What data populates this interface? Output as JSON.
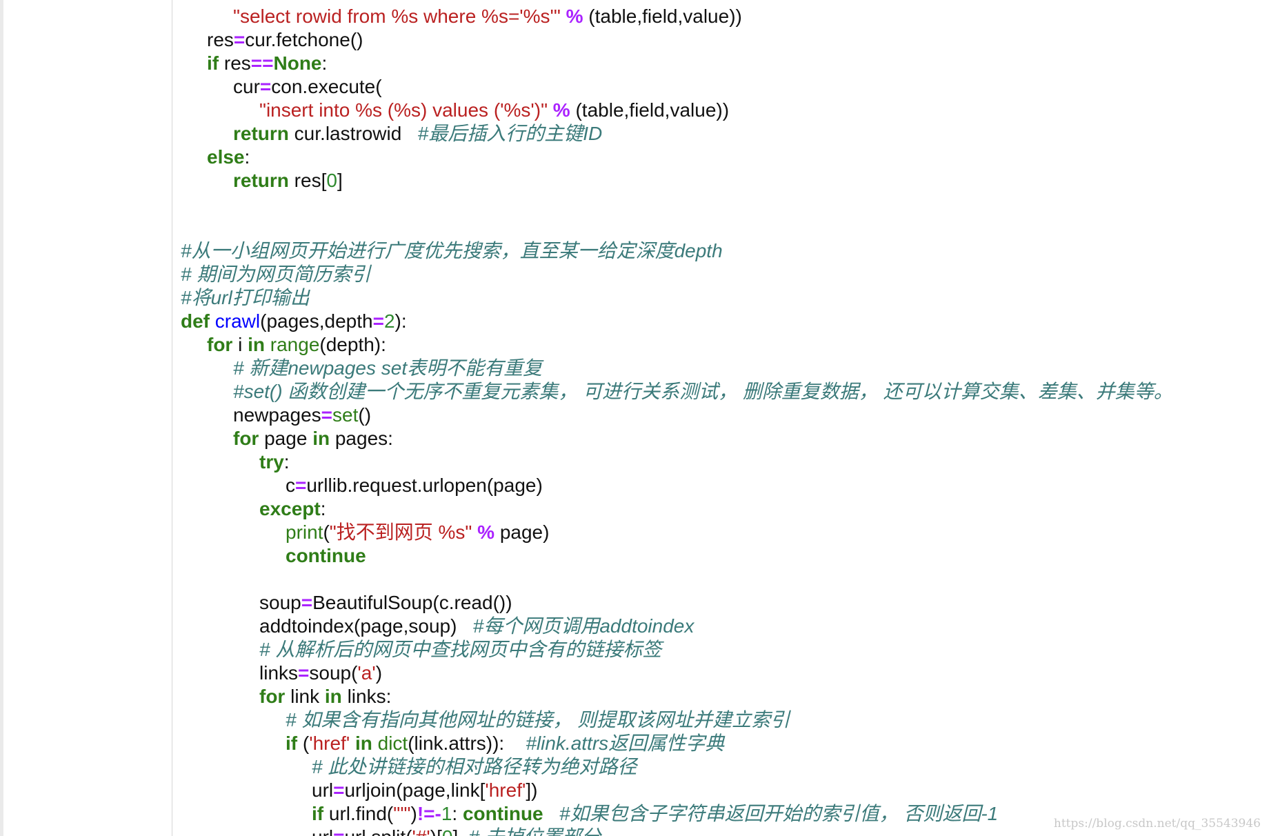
{
  "watermark": "https://blog.csdn.net/qq_35543946",
  "code_lines": [
    {
      "indent": 2,
      "tokens": [
        {
          "t": "str",
          "v": "\"select rowid from %s where %s='%s'\""
        },
        {
          "t": "pl",
          "v": " "
        },
        {
          "t": "op",
          "v": "%"
        },
        {
          "t": "pl",
          "v": " (table,field,value))"
        }
      ]
    },
    {
      "indent": 1,
      "tokens": [
        {
          "t": "pl",
          "v": "res"
        },
        {
          "t": "op",
          "v": "="
        },
        {
          "t": "pl",
          "v": "cur.fetchone()"
        }
      ]
    },
    {
      "indent": 1,
      "tokens": [
        {
          "t": "kw",
          "v": "if"
        },
        {
          "t": "pl",
          "v": " res"
        },
        {
          "t": "op",
          "v": "=="
        },
        {
          "t": "kw",
          "v": "None"
        },
        {
          "t": "pl",
          "v": ":"
        }
      ]
    },
    {
      "indent": 2,
      "tokens": [
        {
          "t": "pl",
          "v": "cur"
        },
        {
          "t": "op",
          "v": "="
        },
        {
          "t": "pl",
          "v": "con.execute("
        }
      ]
    },
    {
      "indent": 3,
      "tokens": [
        {
          "t": "str",
          "v": "\"insert into %s (%s) values ('%s')\""
        },
        {
          "t": "pl",
          "v": " "
        },
        {
          "t": "op",
          "v": "%"
        },
        {
          "t": "pl",
          "v": " (table,field,value))"
        }
      ]
    },
    {
      "indent": 2,
      "tokens": [
        {
          "t": "kw",
          "v": "return"
        },
        {
          "t": "pl",
          "v": " cur.lastrowid   "
        },
        {
          "t": "cm",
          "v": "#最后插入行的主键ID"
        }
      ]
    },
    {
      "indent": 1,
      "tokens": [
        {
          "t": "kw",
          "v": "else"
        },
        {
          "t": "pl",
          "v": ":"
        }
      ]
    },
    {
      "indent": 2,
      "tokens": [
        {
          "t": "kw",
          "v": "return"
        },
        {
          "t": "pl",
          "v": " res["
        },
        {
          "t": "num",
          "v": "0"
        },
        {
          "t": "pl",
          "v": "]"
        }
      ]
    },
    {
      "indent": 0,
      "tokens": []
    },
    {
      "indent": 0,
      "tokens": []
    },
    {
      "indent": 0,
      "tokens": [
        {
          "t": "cm",
          "v": "#从一小组网页开始进行广度优先搜索，直至某一给定深度depth"
        }
      ]
    },
    {
      "indent": 0,
      "tokens": [
        {
          "t": "cm",
          "v": "# 期间为网页简历索引"
        }
      ]
    },
    {
      "indent": 0,
      "tokens": [
        {
          "t": "cm",
          "v": "#将url打印输出"
        }
      ]
    },
    {
      "indent": 0,
      "tokens": [
        {
          "t": "kw",
          "v": "def"
        },
        {
          "t": "pl",
          "v": " "
        },
        {
          "t": "fn",
          "v": "crawl"
        },
        {
          "t": "pl",
          "v": "(pages,depth"
        },
        {
          "t": "op",
          "v": "="
        },
        {
          "t": "num",
          "v": "2"
        },
        {
          "t": "pl",
          "v": "):"
        }
      ]
    },
    {
      "indent": 1,
      "tokens": [
        {
          "t": "kw",
          "v": "for"
        },
        {
          "t": "pl",
          "v": " i "
        },
        {
          "t": "kw",
          "v": "in"
        },
        {
          "t": "pl",
          "v": " "
        },
        {
          "t": "bi",
          "v": "range"
        },
        {
          "t": "pl",
          "v": "(depth):"
        }
      ]
    },
    {
      "indent": 2,
      "tokens": [
        {
          "t": "cm",
          "v": "# 新建newpages set表明不能有重复"
        }
      ]
    },
    {
      "indent": 2,
      "tokens": [
        {
          "t": "cm",
          "v": "#set() 函数创建一个无序不重复元素集， 可进行关系测试， 删除重复数据， 还可以计算交集、差集、并集等。"
        }
      ]
    },
    {
      "indent": 2,
      "tokens": [
        {
          "t": "pl",
          "v": "newpages"
        },
        {
          "t": "op",
          "v": "="
        },
        {
          "t": "bi",
          "v": "set"
        },
        {
          "t": "pl",
          "v": "()"
        }
      ]
    },
    {
      "indent": 2,
      "tokens": [
        {
          "t": "kw",
          "v": "for"
        },
        {
          "t": "pl",
          "v": " page "
        },
        {
          "t": "kw",
          "v": "in"
        },
        {
          "t": "pl",
          "v": " pages:"
        }
      ]
    },
    {
      "indent": 3,
      "tokens": [
        {
          "t": "kw",
          "v": "try"
        },
        {
          "t": "pl",
          "v": ":"
        }
      ]
    },
    {
      "indent": 4,
      "tokens": [
        {
          "t": "pl",
          "v": "c"
        },
        {
          "t": "op",
          "v": "="
        },
        {
          "t": "pl",
          "v": "urllib.request.urlopen(page)"
        }
      ]
    },
    {
      "indent": 3,
      "tokens": [
        {
          "t": "kw",
          "v": "except"
        },
        {
          "t": "pl",
          "v": ":"
        }
      ]
    },
    {
      "indent": 4,
      "tokens": [
        {
          "t": "bi",
          "v": "print"
        },
        {
          "t": "pl",
          "v": "("
        },
        {
          "t": "str",
          "v": "\"找不到网页 %s\""
        },
        {
          "t": "pl",
          "v": " "
        },
        {
          "t": "op",
          "v": "%"
        },
        {
          "t": "pl",
          "v": " page)"
        }
      ]
    },
    {
      "indent": 4,
      "tokens": [
        {
          "t": "kw",
          "v": "continue"
        }
      ]
    },
    {
      "indent": 0,
      "tokens": []
    },
    {
      "indent": 3,
      "tokens": [
        {
          "t": "pl",
          "v": "soup"
        },
        {
          "t": "op",
          "v": "="
        },
        {
          "t": "pl",
          "v": "BeautifulSoup(c.read())"
        }
      ]
    },
    {
      "indent": 3,
      "tokens": [
        {
          "t": "pl",
          "v": "addtoindex(page,soup)   "
        },
        {
          "t": "cm",
          "v": "#每个网页调用addtoindex"
        }
      ]
    },
    {
      "indent": 3,
      "tokens": [
        {
          "t": "cm",
          "v": "# 从解析后的网页中查找网页中含有的链接标签"
        }
      ]
    },
    {
      "indent": 3,
      "tokens": [
        {
          "t": "pl",
          "v": "links"
        },
        {
          "t": "op",
          "v": "="
        },
        {
          "t": "pl",
          "v": "soup("
        },
        {
          "t": "str",
          "v": "'a'"
        },
        {
          "t": "pl",
          "v": ")"
        }
      ]
    },
    {
      "indent": 3,
      "tokens": [
        {
          "t": "kw",
          "v": "for"
        },
        {
          "t": "pl",
          "v": " link "
        },
        {
          "t": "kw",
          "v": "in"
        },
        {
          "t": "pl",
          "v": " links:"
        }
      ]
    },
    {
      "indent": 4,
      "tokens": [
        {
          "t": "cm",
          "v": "# 如果含有指向其他网址的链接， 则提取该网址并建立索引"
        }
      ]
    },
    {
      "indent": 4,
      "tokens": [
        {
          "t": "kw",
          "v": "if"
        },
        {
          "t": "pl",
          "v": " ("
        },
        {
          "t": "str",
          "v": "'href'"
        },
        {
          "t": "pl",
          "v": " "
        },
        {
          "t": "kw",
          "v": "in"
        },
        {
          "t": "pl",
          "v": " "
        },
        {
          "t": "bi",
          "v": "dict"
        },
        {
          "t": "pl",
          "v": "(link.attrs)):    "
        },
        {
          "t": "cm",
          "v": "#link.attrs返回属性字典"
        }
      ]
    },
    {
      "indent": 5,
      "tokens": [
        {
          "t": "cm",
          "v": "# 此处讲链接的相对路径转为绝对路径"
        }
      ]
    },
    {
      "indent": 5,
      "tokens": [
        {
          "t": "pl",
          "v": "url"
        },
        {
          "t": "op",
          "v": "="
        },
        {
          "t": "pl",
          "v": "urljoin(page,link["
        },
        {
          "t": "str",
          "v": "'href'"
        },
        {
          "t": "pl",
          "v": "])"
        }
      ]
    },
    {
      "indent": 5,
      "tokens": [
        {
          "t": "kw",
          "v": "if"
        },
        {
          "t": "pl",
          "v": " url.find("
        },
        {
          "t": "str",
          "v": "\"'\""
        },
        {
          "t": "pl",
          "v": ")"
        },
        {
          "t": "op",
          "v": "!=-"
        },
        {
          "t": "num",
          "v": "1"
        },
        {
          "t": "pl",
          "v": ": "
        },
        {
          "t": "kw",
          "v": "continue"
        },
        {
          "t": "pl",
          "v": "   "
        },
        {
          "t": "cm",
          "v": "#如果包含子字符串返回开始的索引值， 否则返回-1"
        }
      ]
    },
    {
      "indent": 5,
      "tokens": [
        {
          "t": "pl",
          "v": "url"
        },
        {
          "t": "op",
          "v": "="
        },
        {
          "t": "pl",
          "v": "url.split("
        },
        {
          "t": "str",
          "v": "'#'"
        },
        {
          "t": "pl",
          "v": ")["
        },
        {
          "t": "num",
          "v": "0"
        },
        {
          "t": "pl",
          "v": "]  "
        },
        {
          "t": "cm",
          "v": "# 去掉位置部分"
        }
      ]
    }
  ]
}
